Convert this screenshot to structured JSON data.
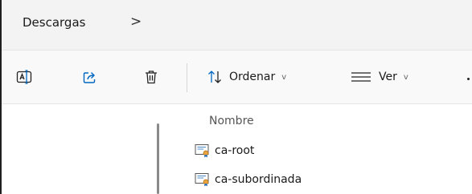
{
  "address_bar": {
    "breadcrumb": "Descargas",
    "separator": ">"
  },
  "toolbar": {
    "rename_icon": "rename-icon",
    "share_icon": "share-icon",
    "delete_icon": "trash-icon",
    "sort": {
      "label": "Ordenar",
      "icon": "sort-arrows-icon",
      "chevron": "v"
    },
    "view": {
      "label": "Ver",
      "icon": "view-lines-icon",
      "chevron": "v"
    }
  },
  "file_list": {
    "column_name": "Nombre",
    "files": [
      {
        "name": "ca-root",
        "icon": "certificate-icon"
      },
      {
        "name": "ca-subordinada",
        "icon": "certificate-icon"
      }
    ]
  },
  "colors": {
    "address_bg": "#f3f3f3",
    "toolbar_bg": "#f9f9f9",
    "icon_blue": "#0067c0",
    "cert_gold": "#e8a33d"
  }
}
